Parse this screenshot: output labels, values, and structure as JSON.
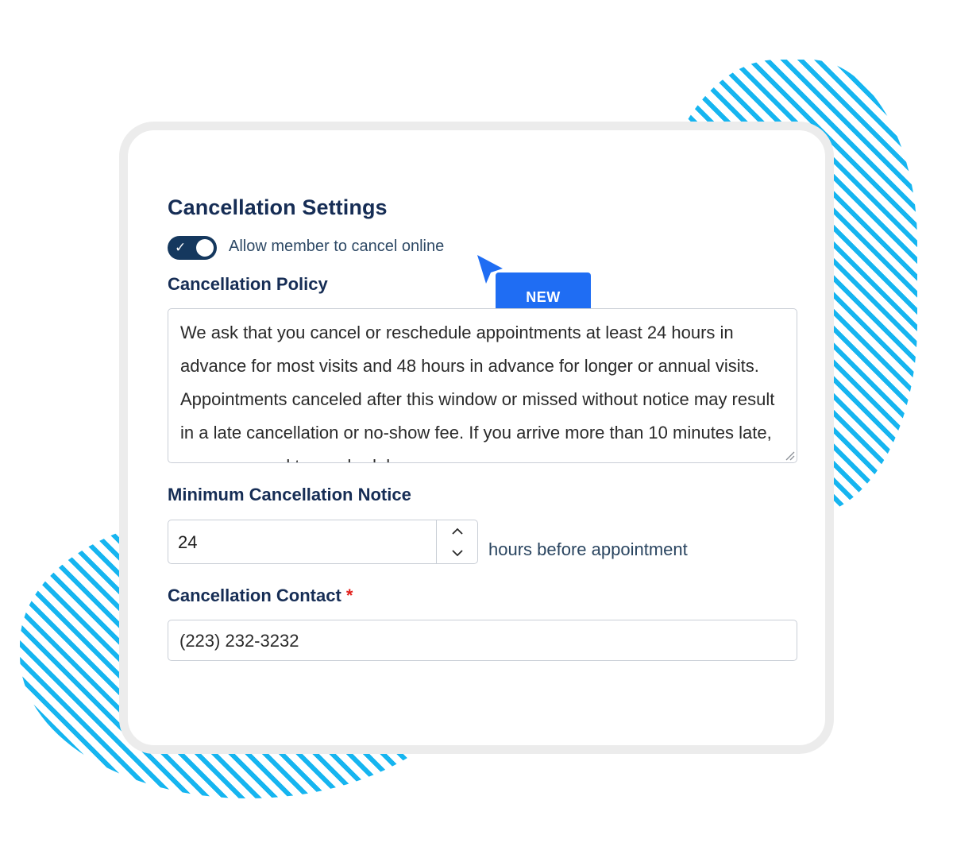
{
  "settings": {
    "title": "Cancellation Settings",
    "toggle": {
      "checked": true,
      "label": "Allow member to cancel online"
    },
    "badge": "NEW",
    "policy": {
      "label": "Cancellation Policy",
      "text": "We ask that you cancel or reschedule appointments at least 24 hours in advance for most visits and 48 hours in advance for longer or annual visits. Appointments canceled after this window or missed without notice may result in a late cancellation or no-show fee. If you arrive more than 10 minutes late, you may need to reschedule."
    },
    "notice": {
      "label": "Minimum Cancellation Notice",
      "value": "24",
      "suffix": "hours before appointment"
    },
    "contact": {
      "label": "Cancellation Contact",
      "required_mark": "*",
      "value": "(223) 232-3232"
    }
  },
  "colors": {
    "accent_blue": "#1f6df3",
    "heading_navy": "#162d55",
    "toggle_on": "#15385e",
    "required_red": "#e2211c",
    "decor_stripes": "#16b5f0"
  },
  "icons": {
    "toggle_check": "check-icon",
    "cursor": "cursor-arrow-icon",
    "stepper_up": "chevron-up-icon",
    "stepper_down": "chevron-down-icon",
    "resize": "resize-handle-icon"
  }
}
